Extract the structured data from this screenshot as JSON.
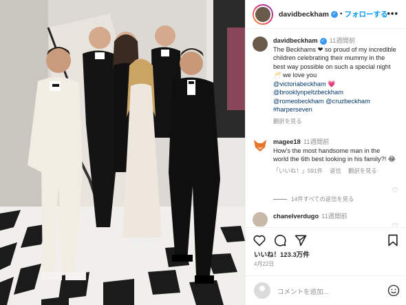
{
  "post": {
    "username": "davidbeckham",
    "follow_label": "フォローする",
    "more_label": "•••",
    "dot": "•"
  },
  "caption": {
    "username": "davidbeckham",
    "time": "11週間前",
    "text_1": "The Beckhams ❤ so proud of my incredible children celebrating their mummy in the best way possible on such a special night 🥂 we love you",
    "tags": [
      "@victoriabeckham",
      "@brooklynpeltzbeckham",
      "@romeobeckham",
      "@cruzbeckham",
      "#harperseven"
    ],
    "heart_emoji": "💗",
    "translate_label": "翻訳を見る"
  },
  "comments": [
    {
      "username": "magee18",
      "time": "11週間前",
      "text": "How's the most handsome man in the world the 6th best looking in his family?! 😂",
      "like_label": "「いいね！」591件",
      "reply_label": "返信",
      "translate_label": "翻訳を見る",
      "replies_label": "14件すべての返信を見る"
    },
    {
      "username": "chanelverdugo",
      "time": "11週間前"
    }
  ],
  "stats": {
    "likes": "いいね！123.3万件",
    "date": "4月22日"
  },
  "composer": {
    "placeholder": "コメントを追加..."
  },
  "colors": {
    "link": "#00376b",
    "follow": "#0095f6",
    "verified": "#3897f0",
    "muted": "#8e8e8e"
  }
}
